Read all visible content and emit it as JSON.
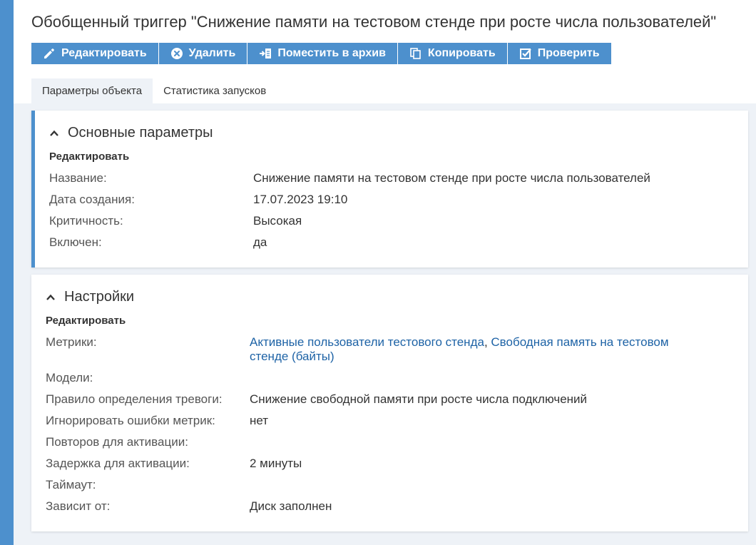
{
  "title": "Обобщенный триггер \"Снижение памяти на тестовом стенде при росте числа пользователей\"",
  "toolbar": {
    "edit": "Редактировать",
    "delete": "Удалить",
    "archive": "Поместить в архив",
    "copy": "Копировать",
    "check": "Проверить"
  },
  "tabs": [
    {
      "label": "Параметры объекта"
    },
    {
      "label": "Статистика запусков"
    }
  ],
  "basic": {
    "heading": "Основные параметры",
    "edit_label": "Редактировать",
    "rows": [
      {
        "label": "Название:",
        "value": "Снижение памяти на тестовом стенде при росте числа пользователей"
      },
      {
        "label": "Дата создания:",
        "value": "17.07.2023 19:10"
      },
      {
        "label": "Критичность:",
        "value": "Высокая"
      },
      {
        "label": "Включен:",
        "value": "да"
      }
    ]
  },
  "settings": {
    "heading": "Настройки",
    "edit_label": "Редактировать",
    "metrics_label": "Метрики:",
    "metrics": [
      "Активные пользователи тестового стенда",
      "Свободная память на тестовом стенде (байты)"
    ],
    "metrics_sep": ", ",
    "models_label": "Модели:",
    "alarm_rule_label": "Правило определения тревоги:",
    "alarm_rule": "Снижение свободной памяти при росте числа подключений",
    "ignore_errors_label": "Игнорировать ошибки метрик:",
    "ignore_errors": "нет",
    "repeats_label": "Повторов для активации:",
    "delay_label": "Задержка для активации:",
    "delay": "2 минуты",
    "timeout_label": "Таймаут:",
    "depends_label": "Зависит от:",
    "depends": "Диск заполнен"
  },
  "colors": {
    "accent": "#4d90cd",
    "link": "#1e63a6",
    "background": "#eef2f7"
  }
}
